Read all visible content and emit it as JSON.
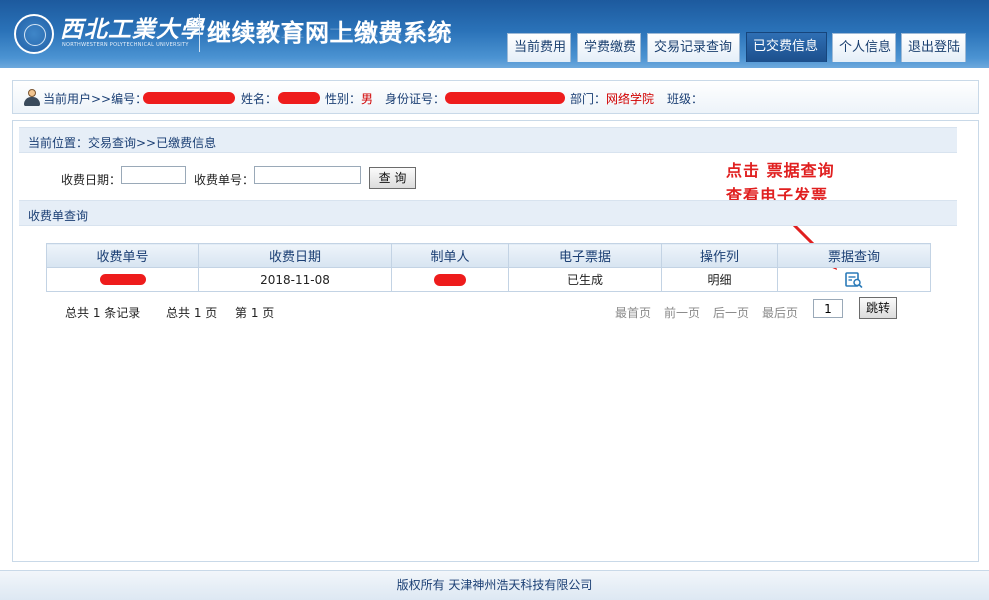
{
  "header": {
    "university_name": "西北工業大學",
    "university_english": "NORTHWESTERN POLYTECHNICAL UNIVERSITY",
    "system_title": "继续教育网上缴费系统"
  },
  "nav": {
    "items": [
      {
        "label": "当前费用"
      },
      {
        "label": "学费缴费"
      },
      {
        "label": "交易记录查询"
      },
      {
        "label": "已交费信息",
        "active": true
      },
      {
        "label": "个人信息"
      },
      {
        "label": "退出登陆"
      }
    ]
  },
  "user_bar": {
    "current_user_label": "当前用户>>编号：",
    "name_label": "姓名：",
    "gender_label": "性别：",
    "gender_value": "男",
    "id_label": "身份证号：",
    "dept_label": "部门：",
    "dept_value": "网络学院",
    "class_label": "班级："
  },
  "breadcrumb": "当前位置：交易查询>>已缴费信息",
  "query_form": {
    "date_label": "收费日期：",
    "date_value": "",
    "receipt_label": "收费单号：",
    "receipt_value": "",
    "search_button": "查 询"
  },
  "section_title": "收费单查询",
  "annotation": {
    "line1": "点击  票据查询",
    "line2": "查看电子发票",
    "color": "#e01f1f"
  },
  "table": {
    "headers": [
      "收费单号",
      "收费日期",
      "制单人",
      "电子票据",
      "操作列",
      "票据查询"
    ],
    "rows": [
      {
        "receipt_no": "",
        "date": "2018-11-08",
        "operator": "",
        "e_invoice": "已生成",
        "action": "明细",
        "invoice_icon": "invoice-search-icon"
      }
    ]
  },
  "pager": {
    "total_records": "总共  1 条记录",
    "total_pages": "总共  1 页",
    "current_page": "第 1 页",
    "first": "最首页",
    "prev": "前一页",
    "next": "后一页",
    "last": "最后页",
    "page_input": "1",
    "jump_button": "跳转"
  },
  "footer": "版权所有 天津神州浩天科技有限公司"
}
